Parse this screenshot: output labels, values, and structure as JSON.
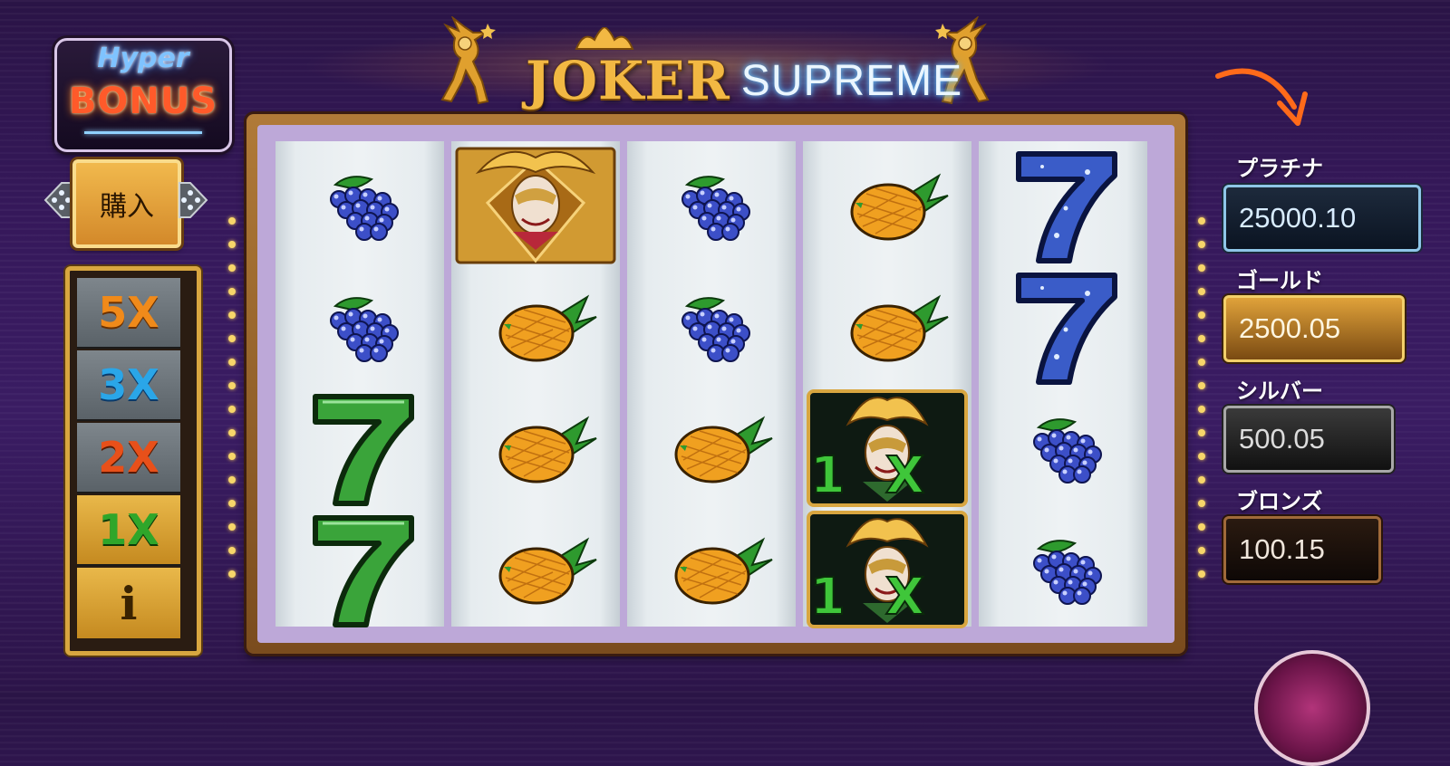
{
  "title": {
    "part1": "JOKER",
    "part2": "SUPREME"
  },
  "hyper_bonus": {
    "line1": "Hyper",
    "line2": "BONUS"
  },
  "buy_button": {
    "label": "購入"
  },
  "multipliers": [
    {
      "label": "5X",
      "color": "#f08a1a"
    },
    {
      "label": "3X",
      "color": "#2aa6e8"
    },
    {
      "label": "2X",
      "color": "#e8501a"
    },
    {
      "label": "1X",
      "color": "#2fa62a"
    }
  ],
  "info_button": {
    "label": "i"
  },
  "reels": [
    [
      "grapes",
      "grapes",
      "seven-green",
      "seven-green"
    ],
    [
      "joker-gold",
      "pineapple",
      "pineapple",
      "pineapple"
    ],
    [
      "grapes",
      "grapes",
      "pineapple",
      "pineapple"
    ],
    [
      "pineapple",
      "pineapple",
      "joker-1x",
      "joker-1x"
    ],
    [
      "seven-blue",
      "seven-blue",
      "grapes",
      "grapes"
    ]
  ],
  "jackpots": [
    {
      "name": "プラチナ",
      "value": "25000.10"
    },
    {
      "name": "ゴールド",
      "value": "2500.05"
    },
    {
      "name": "シルバー",
      "value": "500.05"
    },
    {
      "name": "ブロンズ",
      "value": "100.15"
    }
  ],
  "colors": {
    "accent_orange": "#ff6a1a",
    "frame_gold": "#d8a640",
    "reel_bg": "#eef2f4"
  },
  "joker_symbol_text": "1X"
}
